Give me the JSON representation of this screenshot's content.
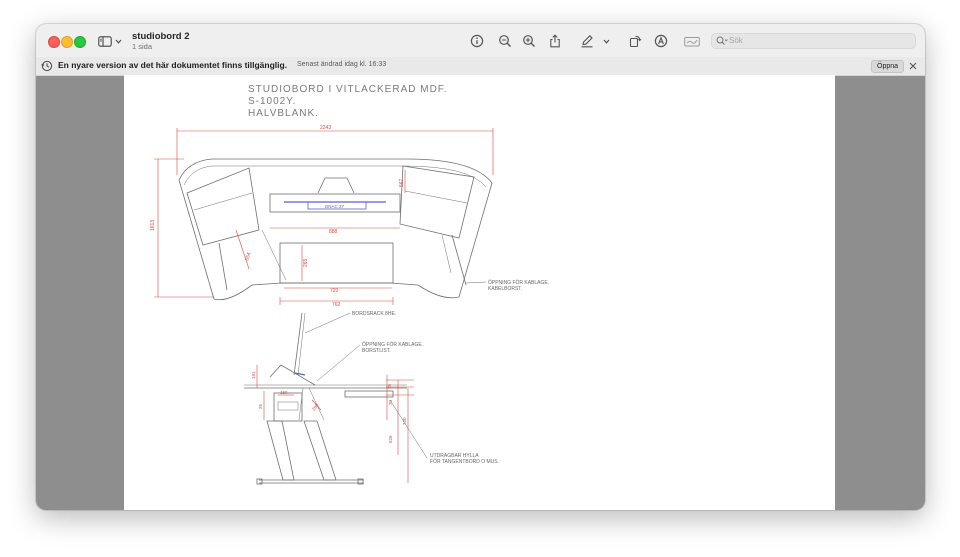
{
  "window": {
    "title": "studiobord 2",
    "subtitle": "1 sida"
  },
  "toolbar": {
    "search_placeholder": "Sök",
    "icons": [
      "sidebar-icon",
      "chevron-down-icon",
      "info-icon",
      "zoom-out-icon",
      "zoom-in-icon",
      "share-icon",
      "markup-pen-icon",
      "chevron-down-icon",
      "rotate-icon",
      "annotate-icon",
      "signature-box-icon",
      "search-icon"
    ]
  },
  "infobar": {
    "message": "En nyare version av det här dokumentet finns tillgänglig.",
    "timestamp": "Senast ändrad idag kl. 16:33",
    "open_label": "Öppna"
  },
  "drawing": {
    "title_lines": [
      "STUDIOBORD I VITLACKERAD MDF.",
      "S-1002Y.",
      "HALVBLANK."
    ],
    "dimensions": {
      "overall_width": "2243",
      "height_left": "1613",
      "side_right": "567",
      "keyboard_area": "888",
      "side_diag": "554",
      "center_h": "265",
      "inner_width": "720",
      "base_width": "762"
    },
    "center_label": "DNAC 27",
    "annotations": {
      "cable_opening_brush": [
        "ÖPPNING FÖR KABLAGE.",
        "KABELBORST."
      ],
      "desk_rack": "BORDSRACK 8HE.",
      "cable_opening_strip": [
        "ÖPPNING FÖR KABLAGE.",
        "BORSTLIST."
      ],
      "keyboard_shelf": [
        "UTDRAGBAR HYLLA",
        "FÖR TANGENTBORD O MUS."
      ]
    },
    "side_dims": [
      "191",
      "25",
      "150",
      "75",
      "730",
      "626",
      "70",
      "280"
    ],
    "colors": {
      "line": "#6f6f6f",
      "dimension": "#d24a3f",
      "monitor": "#5a62c8"
    }
  }
}
